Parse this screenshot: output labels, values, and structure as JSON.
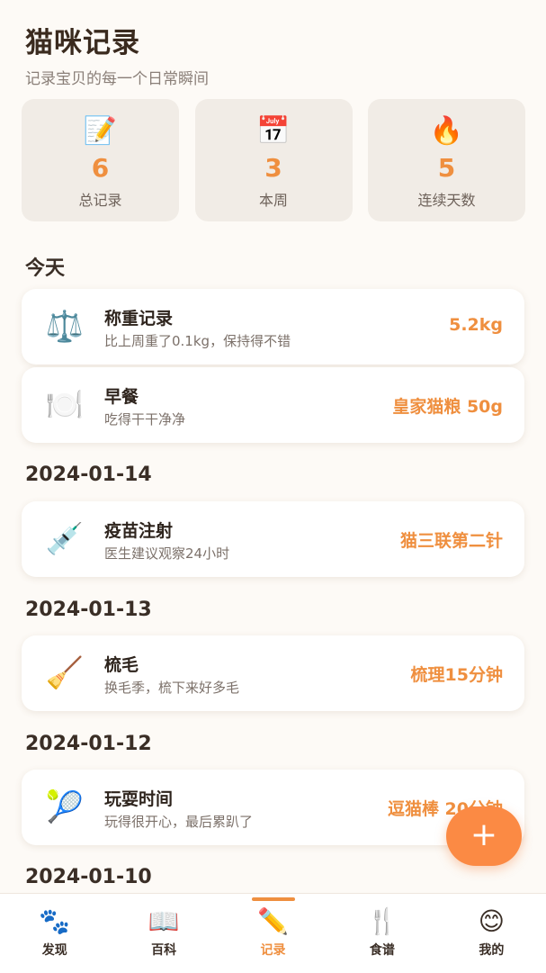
{
  "header": {
    "title": "猫咪记录",
    "subtitle": "记录宝贝的每一个日常瞬间"
  },
  "stats": [
    {
      "icon": "📝",
      "value": "6",
      "label": "总记录"
    },
    {
      "icon": "📅",
      "value": "3",
      "label": "本周"
    },
    {
      "icon": "🔥",
      "value": "5",
      "label": "连续天数"
    }
  ],
  "sections": [
    {
      "date": "今天"
    },
    {
      "date": "2024-01-14"
    },
    {
      "date": "2024-01-13"
    },
    {
      "date": "2024-01-12"
    },
    {
      "date": "2024-01-10"
    }
  ],
  "records": [
    {
      "icon": "⚖️",
      "title": "称重记录",
      "desc": "比上周重了0.1kg，保持得不错",
      "value": "5.2kg"
    },
    {
      "icon": "🍽️",
      "title": "早餐",
      "desc": "吃得干干净净",
      "value": "皇家猫粮 50g"
    },
    {
      "icon": "💉",
      "title": "疫苗注射",
      "desc": "医生建议观察24小时",
      "value": "猫三联第二针"
    },
    {
      "icon": "🧹",
      "title": "梳毛",
      "desc": "换毛季，梳下来好多毛",
      "value": "梳理15分钟"
    },
    {
      "icon": "🎾",
      "title": "玩耍时间",
      "desc": "玩得很开心，最后累趴了",
      "value": "逗猫棒 20分钟"
    }
  ],
  "fab": {
    "label": "+"
  },
  "tabs": [
    {
      "icon": "🐾",
      "label": "发现"
    },
    {
      "icon": "📖",
      "label": "百科"
    },
    {
      "icon": "✏️",
      "label": "记录"
    },
    {
      "icon": "🍴",
      "label": "食谱"
    },
    {
      "icon": "😊",
      "label": "我的"
    }
  ],
  "colors": {
    "accent": "#ef8f3f",
    "fab": "#fb8a44",
    "background": "#fdfaf6",
    "card": "#f1ece6"
  }
}
